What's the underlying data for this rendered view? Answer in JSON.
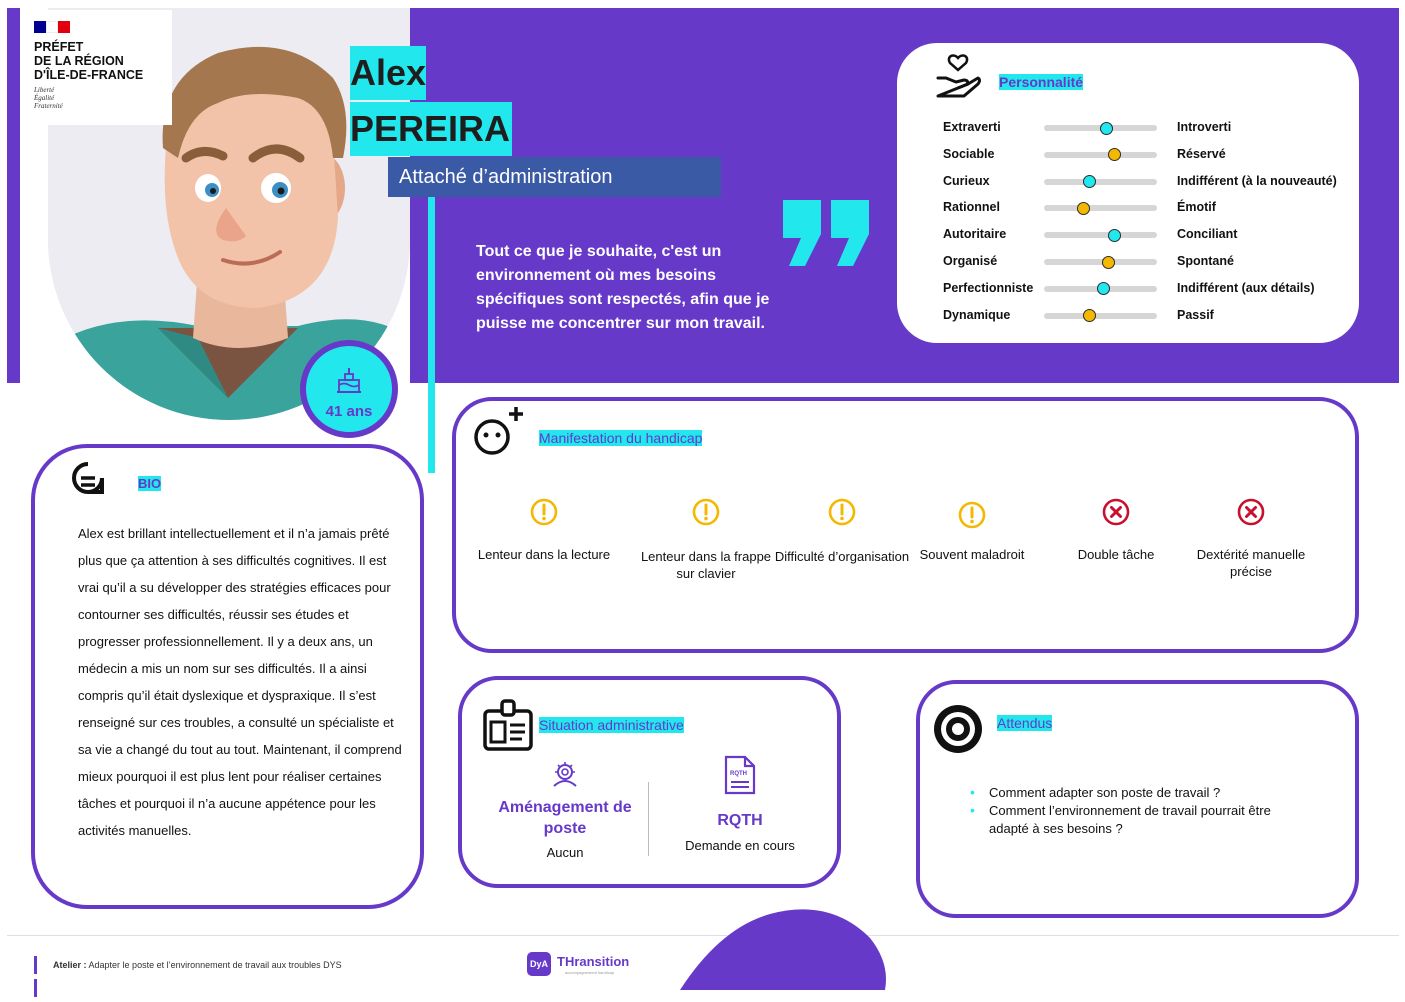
{
  "government": {
    "lines": "PRÉFET\nDE LA RÉGION\nD'ÎLE-DE-FRANCE",
    "motto": "Liberté\nÉgalité\nFraternité",
    "flag_colors": [
      "#000091",
      "#ffffff",
      "#e1000f"
    ]
  },
  "persona": {
    "first_name": "Alex",
    "last_name": "PEREIRA",
    "role": "Attaché d’administration",
    "age": "41 ans",
    "quote": "Tout ce que je souhaite, c'est un environnement où mes besoins spécifiques sont respectés, afin que je puisse me concentrer sur mon travail."
  },
  "personality": {
    "title": "Personnalité",
    "traits": [
      {
        "left": "Extraverti",
        "right": "Introverti",
        "level": 0.55,
        "color": "#22e8ee"
      },
      {
        "left": "Sociable",
        "right": "Réservé",
        "level": 0.62,
        "color": "#f5b800"
      },
      {
        "left": "Curieux",
        "right": "Indifférent (à la nouveauté)",
        "level": 0.4,
        "color": "#22e8ee"
      },
      {
        "left": "Rationnel",
        "right": "Émotif",
        "level": 0.35,
        "color": "#f5b800"
      },
      {
        "left": "Autoritaire",
        "right": "Conciliant",
        "level": 0.62,
        "color": "#22e8ee"
      },
      {
        "left": "Organisé",
        "right": "Spontané",
        "level": 0.57,
        "color": "#f5b800"
      },
      {
        "left": "Perfectionniste",
        "right": "Indifférent (aux détails)",
        "level": 0.53,
        "color": "#22e8ee"
      },
      {
        "left": "Dynamique",
        "right": "Passif",
        "level": 0.4,
        "color": "#f5b800"
      }
    ]
  },
  "handicap": {
    "title": "Manifestation du handicap",
    "items": [
      {
        "label": "Lenteur dans la lecture",
        "status": "warning"
      },
      {
        "label": "Lenteur dans la frappe sur clavier",
        "status": "warning"
      },
      {
        "label": "Difficulté d’organisation",
        "status": "warning"
      },
      {
        "label": "Souvent maladroit",
        "status": "warning"
      },
      {
        "label": "Double tâche",
        "status": "blocked"
      },
      {
        "label": "Dextérité manuelle précise",
        "status": "blocked"
      }
    ],
    "colors": {
      "warning": "#f5b800",
      "blocked": "#c8102e"
    }
  },
  "bio": {
    "title": "BIO",
    "text": "Alex est brillant intellectuellement et il n’a jamais prêté plus que ça attention à ses difficultés cognitives. Il est vrai qu’il a su développer des stratégies efficaces pour contourner ses difficultés, réussir ses études et progresser professionnellement. Il y a deux ans, un médecin a mis un nom sur ses difficultés. Il a ainsi compris qu’il était dyslexique et dyspraxique. Il s’est renseigné sur ces troubles, a consulté un spécialiste et sa vie a changé du tout au tout. Maintenant, il comprend mieux pourquoi il est plus lent pour réaliser certaines tâches et pourquoi il n’a aucune appétence pour les activités manuelles."
  },
  "admin": {
    "title": "Situation administrative",
    "amenagement_label": "Aménagement de poste",
    "amenagement_value": "Aucun",
    "rqth_label": "RQTH",
    "rqth_value": "Demande en cours",
    "rqth_icon_text": "RQTH"
  },
  "attendus": {
    "title": "Attendus",
    "items": [
      "Comment adapter son poste de travail ?",
      "Comment l’environnement de travail pourrait être adapté à ses besoins ?"
    ]
  },
  "footer": {
    "label": "Atelier :",
    "text": "Adapter le poste et l’environnement de travail aux troubles DYS",
    "logo_badge": "DyA",
    "logo_text": "THransition",
    "logo_tagline": "accompagnement handicap"
  },
  "colors": {
    "primary": "#6639c9",
    "accent": "#22e8ee",
    "role_bg": "#3b5aa6"
  }
}
